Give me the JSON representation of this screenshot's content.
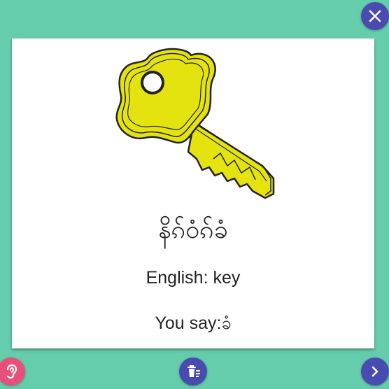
{
  "card": {
    "image": {
      "subject": "key",
      "fill_color": "#e4e310",
      "outline_color": "#222222"
    },
    "native_word": " နိၵ်ဝံၵ်ခံ",
    "english_line": "English: key",
    "you_say_line": "You say:ခံ"
  },
  "controls": {
    "close_icon": "close-icon",
    "listen_icon": "ear-icon",
    "delete_icon": "delete-list-icon",
    "next_icon": "chevron-right-icon"
  },
  "colors": {
    "background": "#65cdab",
    "button": "#4a4bb1",
    "listen_button": "#e8507b"
  }
}
